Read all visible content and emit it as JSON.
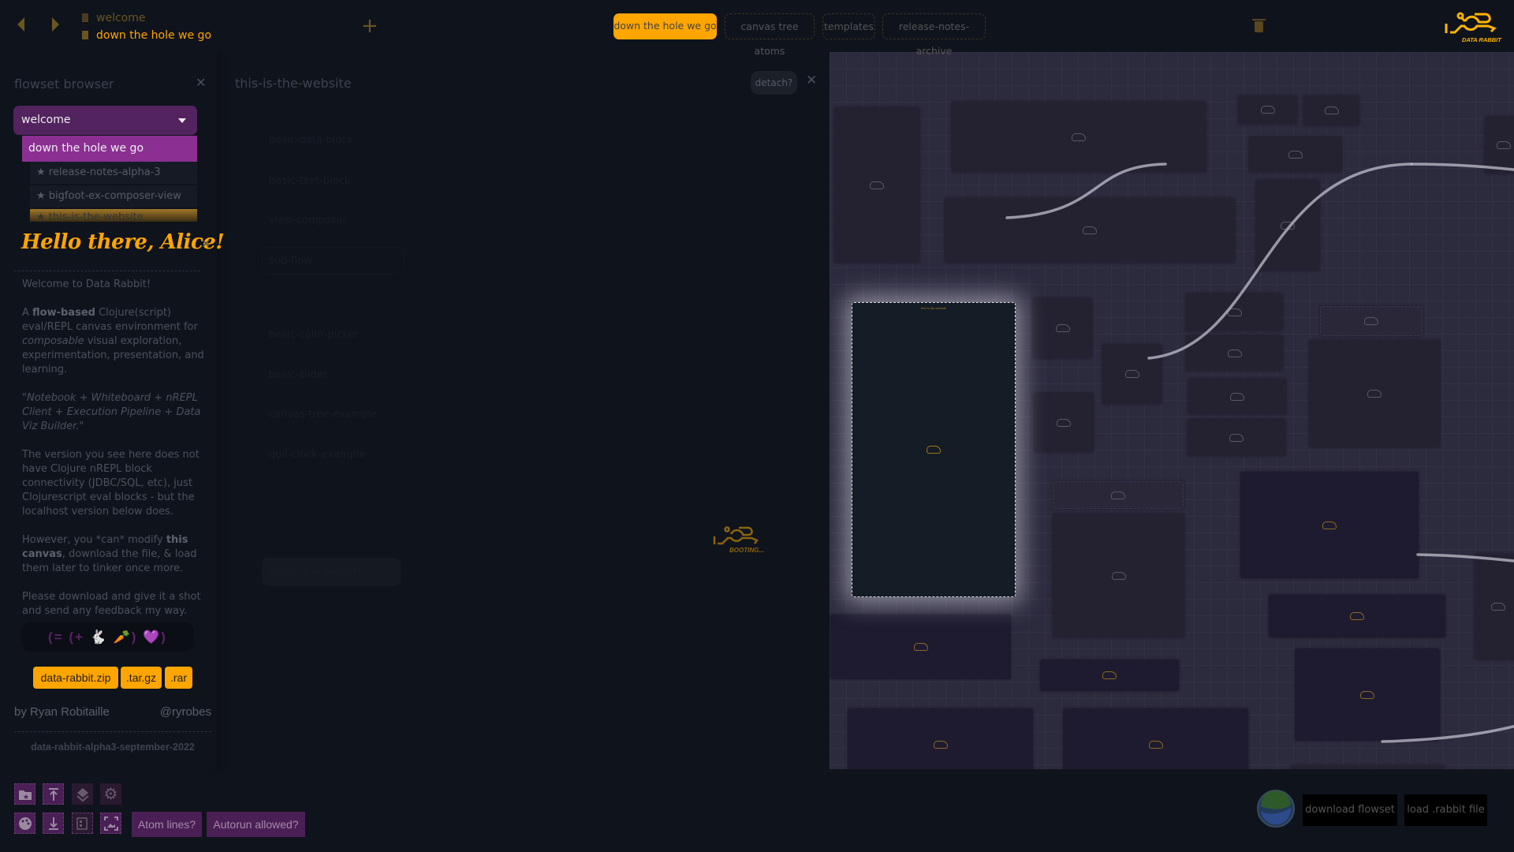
{
  "topbar": {
    "tabs": [
      {
        "label": "welcome",
        "active": false
      },
      {
        "label": "down the hole we go",
        "active": true
      }
    ],
    "flow_tabs": [
      {
        "label": "down the hole we go",
        "active": true
      },
      {
        "label": "canvas tree atoms",
        "active": false
      },
      {
        "label": "templates",
        "active": false
      },
      {
        "label": "release-notes-archive",
        "active": false
      }
    ],
    "logo_text": "DATA RABBIT"
  },
  "flowset_browser": {
    "title": "flowset browser",
    "selected": "welcome",
    "options": [
      "down the hole we go",
      "release-notes-alpha-3",
      "bigfoot-ex-composer-view",
      "this-is-the-website"
    ]
  },
  "welcome_panel": {
    "heading": "Hello there, Alice!",
    "intro": "Welcome to Data Rabbit!",
    "p1_a": "A ",
    "p1_bold": "flow-based",
    "p1_b": " Clojure(script) eval/REPL canvas environment for ",
    "p1_italic": "composable",
    "p1_c": " visual exploration, experimentation, presentation, and learning.",
    "quote": "\"Notebook + Whiteboard + nREPL Client + Execution Pipeline + Data Viz Builder.\"",
    "p2": "The version you see here does not have Clojure nREPL block connectivity (JDBC/SQL, etc), just Clojurescript eval blocks - but the localhost version below does.",
    "p3_a": "However, you *can* modify ",
    "p3_bold": "this canvas",
    "p3_b": ", download the file, & load them later to tinker once more.",
    "p4": "Please download and give it a shot and send any feedback my way.",
    "emoji_code": "(= (+ 🐇 🥕) 💜)",
    "downloads": [
      "data-rabbit.zip",
      ".tar.gz",
      ".rar"
    ],
    "author": "by Ryan Robitaille",
    "handle": "@ryrobes",
    "version": "data-rabbit-alpha3-september-2022"
  },
  "block_panel": {
    "title": "this-is-the-website",
    "detach_label": "detach?",
    "items": [
      "basic-data-block",
      "basic-text-block",
      "view-composer",
      "sub-flow",
      "basic-color-picker",
      "basic-slider",
      "canvas-tree-example",
      "quil-clock-example",
      "this-is-the-website"
    ],
    "booting_text": "BOOTING..."
  },
  "canvas": {
    "highlighted_block": "this-is-the-website"
  },
  "bottombar": {
    "icons": [
      "folder-star-icon",
      "upload-icon",
      "layers-icon",
      "gear-icon",
      "palette-icon",
      "download-icon",
      "report-icon",
      "image-frame-icon"
    ],
    "atom_lines_label": "Atom lines?",
    "autorun_label": "Autorun allowed?",
    "download_flowset_label": "download flowset",
    "load_file_label": "load .rabbit file"
  },
  "colors": {
    "accent": "#ffa500",
    "purple": "#52235e",
    "selected_purple": "#8b2f93",
    "canvas_bg": "#2c2a3d"
  }
}
